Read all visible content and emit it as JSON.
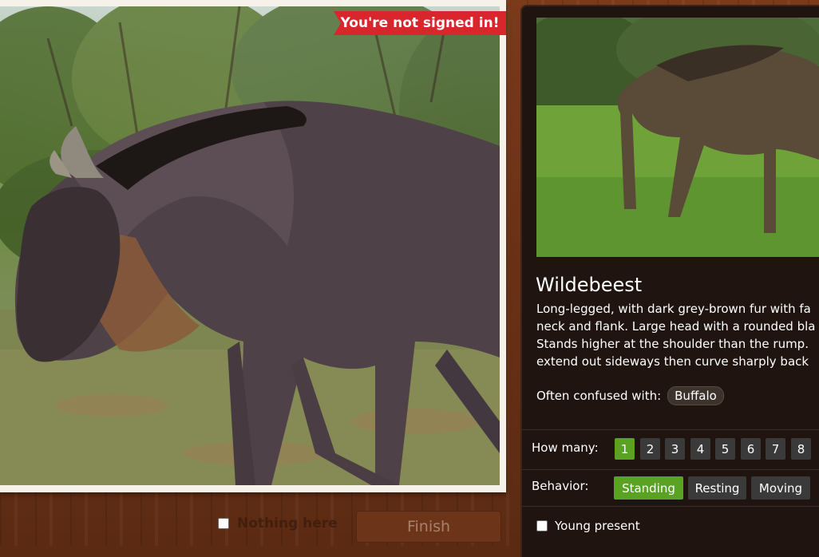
{
  "banner": {
    "text": "You're not signed in!"
  },
  "bottom_controls": {
    "nothing_here_label": "Nothing here",
    "finish_label": "Finish"
  },
  "species": {
    "title": "Wildebeest",
    "description_lines": [
      "Long-legged, with dark grey-brown fur with fa",
      "neck and flank. Large head with a rounded bla",
      "Stands higher at the shoulder than the rump.",
      "extend out sideways then curve sharply back"
    ],
    "confused_label": "Often confused with:",
    "confused_with": [
      "Buffalo"
    ]
  },
  "how_many": {
    "label": "How many:",
    "options": [
      "1",
      "2",
      "3",
      "4",
      "5",
      "6",
      "7",
      "8"
    ],
    "selected": "1"
  },
  "behavior": {
    "label": "Behavior:",
    "options": [
      "Standing",
      "Resting",
      "Moving"
    ],
    "selected": "Standing"
  },
  "young_present": {
    "label": "Young present",
    "checked": false
  },
  "colors": {
    "accent_green": "#5aa221",
    "banner_red": "#d9252c",
    "panel_bg": "#1f1410"
  }
}
